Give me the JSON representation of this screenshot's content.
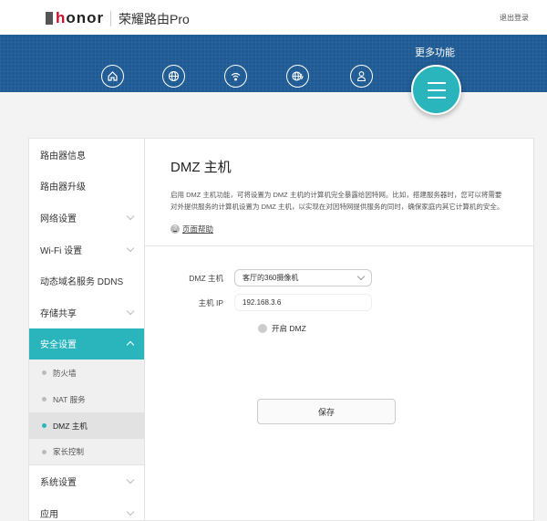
{
  "header": {
    "brand": "honor",
    "title": "荣耀路由Pro",
    "logout": "退出登录"
  },
  "banner": {
    "more_label": "更多功能",
    "icons": [
      "home-icon",
      "globe-icon",
      "wifi-icon",
      "globe-speed-icon",
      "user-icon"
    ]
  },
  "sidebar": {
    "items": [
      {
        "label": "路由器信息"
      },
      {
        "label": "路由器升级"
      },
      {
        "label": "网络设置"
      },
      {
        "label": "Wi-Fi 设置"
      },
      {
        "label": "动态域名服务 DDNS"
      },
      {
        "label": "存储共享"
      },
      {
        "label": "安全设置"
      }
    ],
    "sub_items": [
      {
        "label": "防火墙"
      },
      {
        "label": "NAT 服务"
      },
      {
        "label": "DMZ 主机"
      },
      {
        "label": "家长控制"
      }
    ],
    "after": [
      {
        "label": "系统设置"
      },
      {
        "label": "应用"
      }
    ]
  },
  "main": {
    "title": "DMZ 主机",
    "description": "启用 DMZ 主机功能，可将设置为 DMZ 主机的计算机完全暴露给因特网。比如，搭建服务器时，您可以将需要对外提供服务的计算机设置为 DMZ 主机，以实现在对因特网提供服务的同时，确保家庭内其它计算机的安全。",
    "help": "页面帮助",
    "form": {
      "host_label": "DMZ 主机",
      "host_value": "客厅的360摄像机",
      "ip_label": "主机 IP",
      "ip_value": "192.168.3.6",
      "enable_label": "开启 DMZ",
      "enabled": false
    },
    "save": "保存"
  },
  "colors": {
    "accent": "#2ab5bd",
    "banner": "#1e5b94"
  }
}
